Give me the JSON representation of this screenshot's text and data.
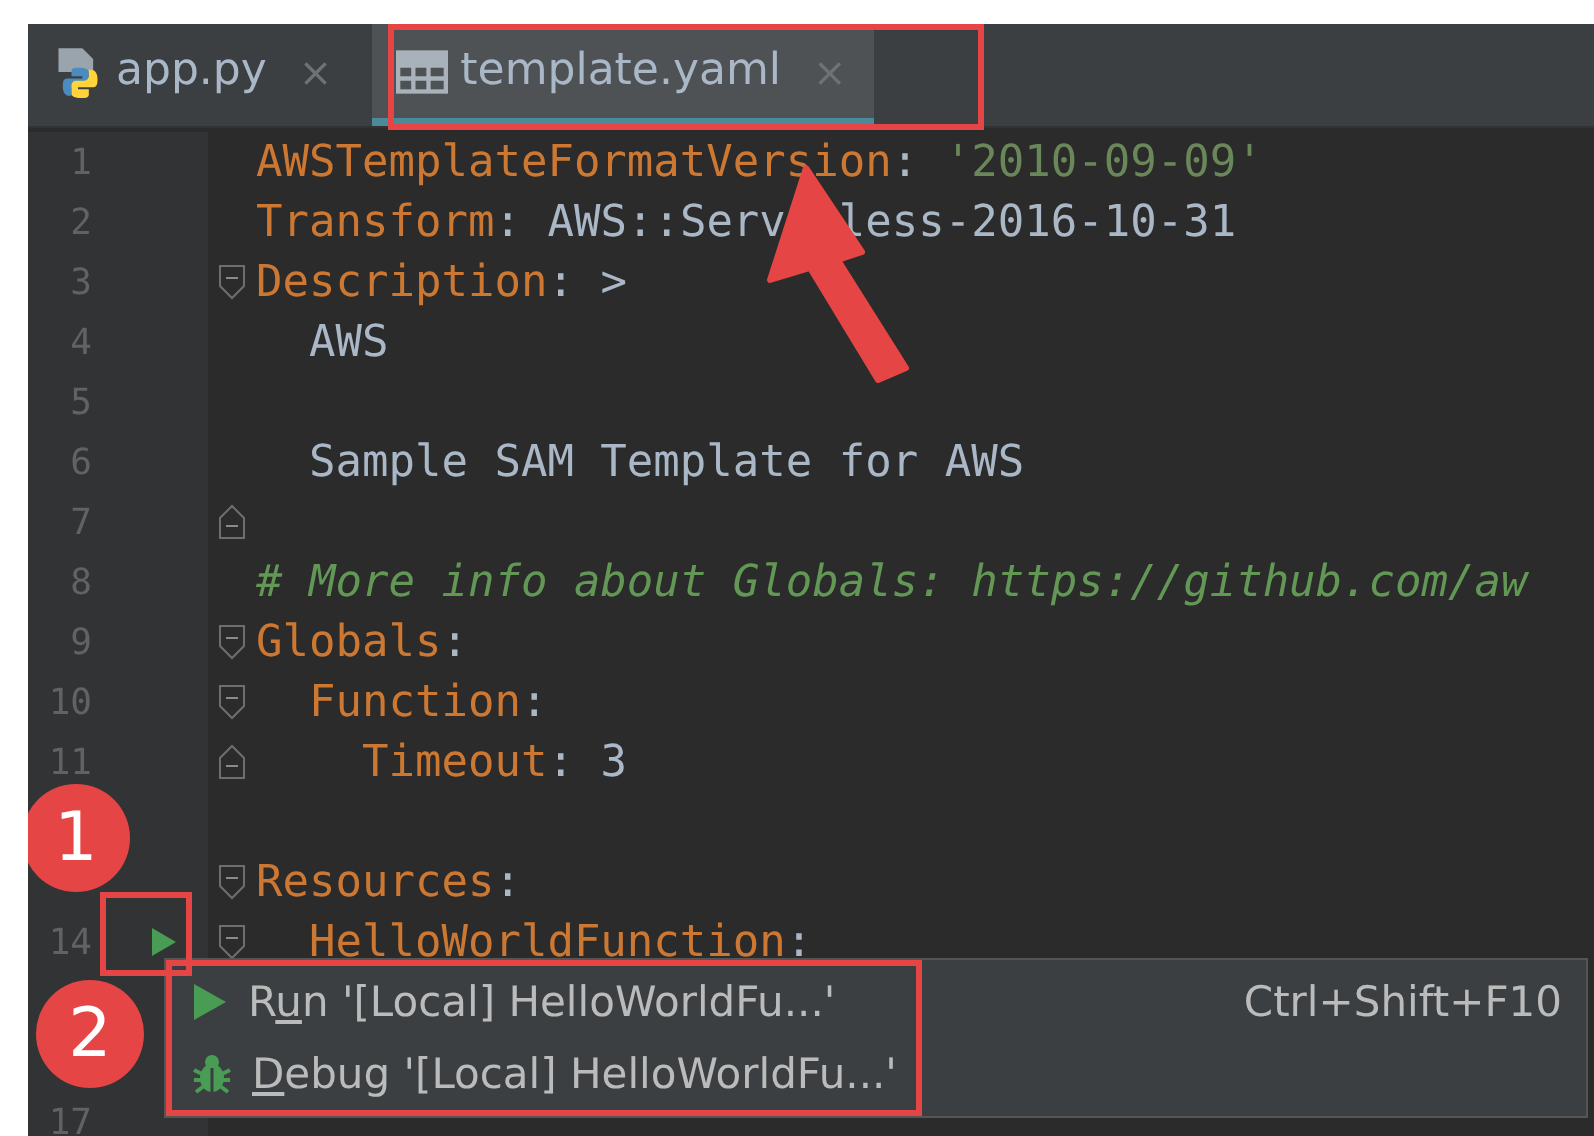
{
  "tabs": [
    {
      "label": "app.py",
      "kind": "python",
      "selected": false,
      "close": "×"
    },
    {
      "label": "template.yaml",
      "kind": "table",
      "selected": true,
      "close": "×"
    }
  ],
  "editor": {
    "lines": [
      {
        "kind": "code",
        "number": "1",
        "tokens": [
          {
            "kind": "key",
            "text": "AWSTemplateFormatVersion"
          },
          {
            "kind": "punct",
            "text": ": "
          },
          {
            "kind": "string",
            "text": "'2010-09-09'"
          }
        ]
      },
      {
        "kind": "code",
        "number": "2",
        "tokens": [
          {
            "kind": "key",
            "text": "Transform"
          },
          {
            "kind": "punct",
            "text": ": "
          },
          {
            "kind": "plain",
            "text": "AWS::Serv"
          },
          {
            "kind": "plain",
            "text": "less-2016-10-31",
            "gap_before": true
          }
        ]
      },
      {
        "kind": "code",
        "number": "3",
        "fold_start": true,
        "tokens": [
          {
            "kind": "key",
            "text": "Description"
          },
          {
            "kind": "punct",
            "text": ": >"
          }
        ]
      },
      {
        "kind": "code",
        "number": "4",
        "tokens": [
          {
            "kind": "plain",
            "text": "  AWS"
          }
        ]
      },
      {
        "kind": "code",
        "number": "5"
      },
      {
        "kind": "code",
        "number": "6",
        "tokens": [
          {
            "kind": "plain",
            "text": "  Sample SAM Template for AWS"
          }
        ]
      },
      {
        "kind": "code",
        "number": "7",
        "fold_end": true
      },
      {
        "kind": "code",
        "number": "8",
        "tokens": [
          {
            "kind": "comment",
            "text": "# More info about Globals: https://github.com/aw"
          }
        ]
      },
      {
        "kind": "code",
        "number": "9",
        "fold_start": true,
        "tokens": [
          {
            "kind": "key",
            "text": "Globals"
          },
          {
            "kind": "punct",
            "text": ":"
          }
        ]
      },
      {
        "kind": "code",
        "number": "10",
        "fold_start": true,
        "tokens": [
          {
            "kind": "key",
            "text": "  Function"
          },
          {
            "kind": "punct",
            "text": ":"
          }
        ]
      },
      {
        "kind": "code",
        "number": "11",
        "fold_end": true,
        "tokens": [
          {
            "kind": "key",
            "text": "    Timeout"
          },
          {
            "kind": "punct",
            "text": ": "
          },
          {
            "kind": "plain",
            "text": "3"
          }
        ]
      },
      {
        "kind": "blank"
      },
      {
        "kind": "code",
        "fold_start": true,
        "tokens": [
          {
            "kind": "key",
            "text": "Resources"
          },
          {
            "kind": "punct",
            "text": ":"
          }
        ]
      },
      {
        "kind": "code",
        "number": "14",
        "fold_start": true,
        "run_marker": true,
        "tokens": [
          {
            "kind": "key",
            "text": "  HelloWorldFunction"
          },
          {
            "kind": "punct",
            "text": ":"
          }
        ]
      },
      {
        "kind": "blank"
      },
      {
        "kind": "blank"
      },
      {
        "kind": "code",
        "number": "17"
      }
    ]
  },
  "popup": {
    "items": [
      {
        "kind": "run",
        "before": "R",
        "mnemonic": "u",
        "after": "n '[Local] HelloWorldFu...'",
        "shortcut": "Ctrl+Shift+F10"
      },
      {
        "kind": "debug",
        "mnemonic": "D",
        "after": "ebug '[Local] HelloWorldFu...'"
      }
    ]
  },
  "annotations": {
    "badges": [
      "1",
      "2"
    ]
  }
}
